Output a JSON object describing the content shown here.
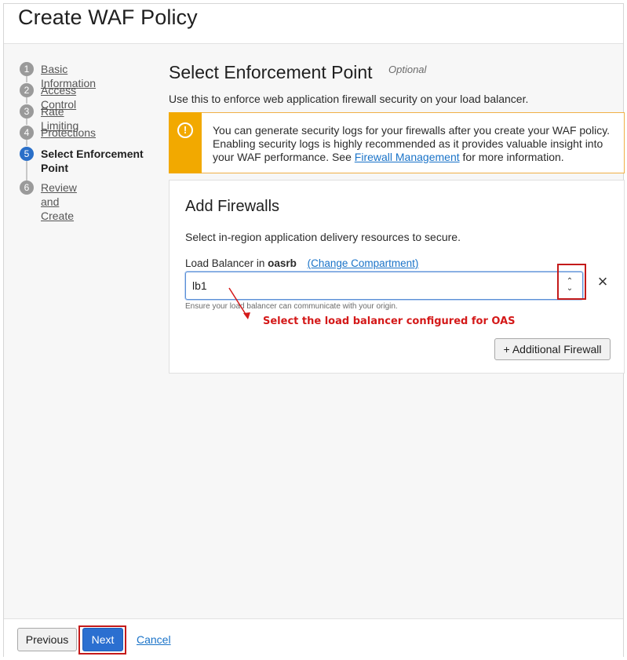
{
  "header": {
    "title": "Create WAF Policy"
  },
  "steps": [
    {
      "num": "1",
      "label": "Basic Information"
    },
    {
      "num": "2",
      "label": "Access Control"
    },
    {
      "num": "3",
      "label": "Rate Limiting"
    },
    {
      "num": "4",
      "label": "Protections"
    },
    {
      "num": "5",
      "label": "Select Enforcement Point",
      "active": true
    },
    {
      "num": "6",
      "label": "Review and Create"
    }
  ],
  "main": {
    "title": "Select Enforcement Point",
    "optional": "Optional",
    "description": "Use this to enforce web application firewall security on your load balancer."
  },
  "alert": {
    "icon": "warning-icon",
    "text_before": "You can generate security logs for your firewalls after you create your WAF policy. Enabling security logs is highly recommended as it provides valuable insight into your WAF performance. See ",
    "link": "Firewall Management",
    "text_after": " for more information."
  },
  "card": {
    "title": "Add Firewalls",
    "subtitle": "Select in-region application delivery resources to secure.",
    "field_label": "Load Balancer in ",
    "compartment": "oasrb",
    "change_link": "(Change Compartment)",
    "selected_value": "lb1",
    "hint": "Ensure your load balancer can communicate with your origin.",
    "annotation": "Select the load balancer configured for OAS",
    "add_button": "+ Additional Firewall"
  },
  "footer": {
    "previous": "Previous",
    "next": "Next",
    "cancel": "Cancel"
  },
  "colors": {
    "accent": "#2b6fd0",
    "warning": "#f2a900",
    "annotation": "#d41919"
  }
}
